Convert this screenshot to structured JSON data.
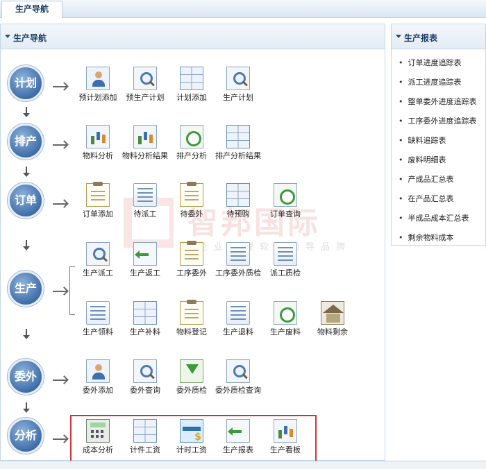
{
  "top_tab": "生产导航",
  "nav_panel": {
    "title": "生产导航"
  },
  "report_panel": {
    "title": "生产报表",
    "items": [
      "订单进度追踪表",
      "派工进度追踪表",
      "整单委外进度追踪表",
      "工序委外进度追踪表",
      "缺料追踪表",
      "废料明细表",
      "产成品汇总表",
      "在产品汇总表",
      "半成品成本汇总表",
      "剩余物料成本"
    ]
  },
  "stages": [
    "计划",
    "排产",
    "订单",
    "生产",
    "委外",
    "分析"
  ],
  "modules": {
    "plan": [
      "预计划添加",
      "预生产计划",
      "计划添加",
      "生产计划"
    ],
    "schedule": [
      "物料分析",
      "物料分析结果",
      "排产分析",
      "排产分析结果"
    ],
    "order": [
      "订单添加",
      "待派工",
      "待委外",
      "待预购",
      "订单查询"
    ],
    "production_row1": [
      "生产派工",
      "生产返工",
      "工序委外",
      "工序委外质检",
      "派工质检"
    ],
    "production_row2": [
      "生产领料",
      "生产补料",
      "物料登记",
      "生产退料",
      "生产废料",
      "物料剩余"
    ],
    "outsource": [
      "委外添加",
      "委外查询",
      "委外质检",
      "委外质检查询"
    ],
    "analysis": [
      "成本分析",
      "计件工资",
      "计时工资",
      "生产报表",
      "生产看板"
    ]
  },
  "watermark": {
    "title": "智邦国际",
    "subtitle": "企业管理软件领导品牌"
  },
  "icons": {
    "plan": [
      "form-person-icon",
      "search-window-icon",
      "add-sheet-icon",
      "magnifier-doc-icon"
    ],
    "schedule": [
      "bar-chart-icon",
      "chart-result-icon",
      "clock-check-icon",
      "grid-chart-icon"
    ],
    "order": [
      "clipboard-icon",
      "dispatch-list-icon",
      "clipboard-person-icon",
      "xls-sheet-icon",
      "clock-search-icon"
    ],
    "production_row1": [
      "search-doc-icon",
      "return-arrow-icon",
      "clipboard-icon",
      "doc-stamp-icon",
      "shield-check-icon"
    ],
    "production_row2": [
      "pencil-icon",
      "transfer-icon",
      "clipboard-check-icon",
      "upload-doc-icon",
      "recycle-icon",
      "warehouse-icon"
    ],
    "outsource": [
      "person-card-icon",
      "magnifier-icon",
      "download-tray-icon",
      "folder-search-icon"
    ],
    "analysis": [
      "calculator-icon",
      "keyboard-icon",
      "money-card-icon",
      "exit-arrow-icon",
      "dashboard-chart-icon"
    ]
  },
  "colors": {
    "accent": "#3f6ea8",
    "highlight_border": "#d9322e",
    "header_text": "#1f3f66"
  }
}
